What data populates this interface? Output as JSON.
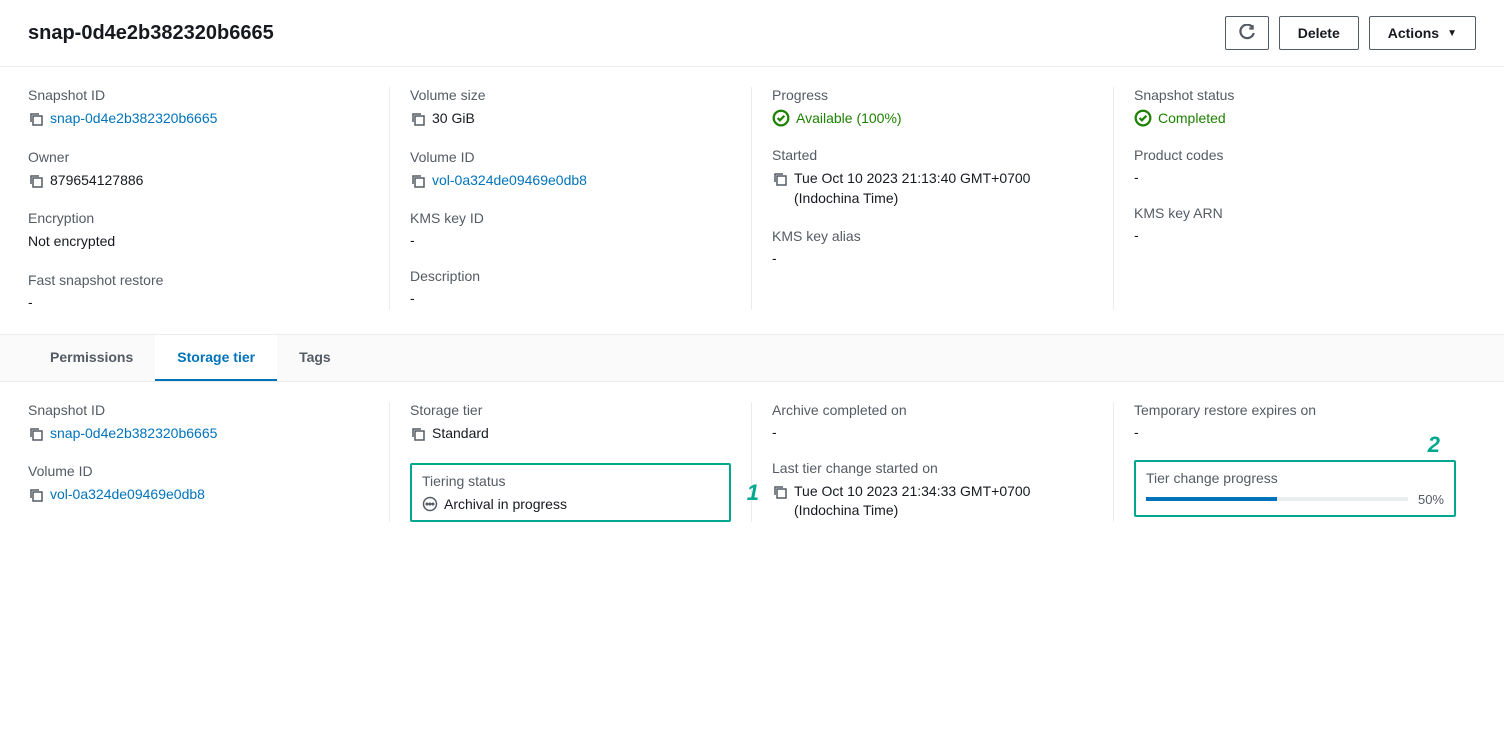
{
  "header": {
    "title": "snap-0d4e2b382320b6665",
    "delete_label": "Delete",
    "actions_label": "Actions"
  },
  "details": {
    "snapshot_id": {
      "label": "Snapshot ID",
      "value": "snap-0d4e2b382320b6665"
    },
    "owner": {
      "label": "Owner",
      "value": "879654127886"
    },
    "encryption": {
      "label": "Encryption",
      "value": "Not encrypted"
    },
    "fast_restore": {
      "label": "Fast snapshot restore",
      "value": "-"
    },
    "volume_size": {
      "label": "Volume size",
      "value": "30 GiB"
    },
    "volume_id": {
      "label": "Volume ID",
      "value": "vol-0a324de09469e0db8"
    },
    "kms_key_id": {
      "label": "KMS key ID",
      "value": "-"
    },
    "description": {
      "label": "Description",
      "value": "-"
    },
    "progress": {
      "label": "Progress",
      "value": "Available (100%)"
    },
    "started": {
      "label": "Started",
      "value": "Tue Oct 10 2023 21:13:40 GMT+0700 (Indochina Time)"
    },
    "kms_key_alias": {
      "label": "KMS key alias",
      "value": "-"
    },
    "snapshot_status": {
      "label": "Snapshot status",
      "value": "Completed"
    },
    "product_codes": {
      "label": "Product codes",
      "value": "-"
    },
    "kms_key_arn": {
      "label": "KMS key ARN",
      "value": "-"
    }
  },
  "tabs": {
    "permissions": "Permissions",
    "storage_tier": "Storage tier",
    "tags": "Tags"
  },
  "storage": {
    "snapshot_id": {
      "label": "Snapshot ID",
      "value": "snap-0d4e2b382320b6665"
    },
    "volume_id": {
      "label": "Volume ID",
      "value": "vol-0a324de09469e0db8"
    },
    "storage_tier": {
      "label": "Storage tier",
      "value": "Standard"
    },
    "tiering_status": {
      "label": "Tiering status",
      "value": "Archival in progress"
    },
    "archive_completed": {
      "label": "Archive completed on",
      "value": "-"
    },
    "last_tier_change": {
      "label": "Last tier change started on",
      "value": "Tue Oct 10 2023 21:34:33 GMT+0700 (Indochina Time)"
    },
    "temp_restore": {
      "label": "Temporary restore expires on",
      "value": "-"
    },
    "tier_progress": {
      "label": "Tier change progress",
      "percent": "50%"
    }
  },
  "callouts": {
    "one": "1",
    "two": "2"
  }
}
